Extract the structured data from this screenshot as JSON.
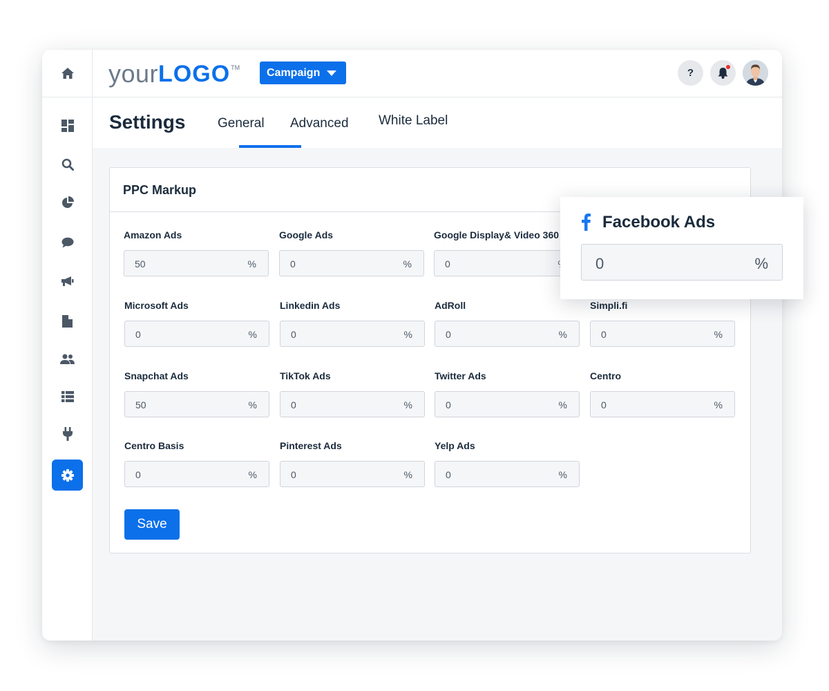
{
  "brand": {
    "logo_part1": "your",
    "logo_part2": "LOGO",
    "logo_tm": "TM"
  },
  "header": {
    "campaign_label": "Campaign",
    "help_label": "?"
  },
  "sidebar": {
    "items": [
      {
        "icon": "home-icon"
      },
      {
        "icon": "dashboard-icon"
      },
      {
        "icon": "search-icon"
      },
      {
        "icon": "pie-chart-icon"
      },
      {
        "icon": "chat-icon"
      },
      {
        "icon": "megaphone-icon"
      },
      {
        "icon": "document-icon"
      },
      {
        "icon": "users-icon"
      },
      {
        "icon": "list-icon"
      },
      {
        "icon": "plug-icon"
      },
      {
        "icon": "gear-icon",
        "active": true
      }
    ]
  },
  "settings": {
    "title": "Settings",
    "tabs": [
      {
        "label": "General"
      },
      {
        "label": "Advanced",
        "active": true
      },
      {
        "label": "White Label"
      }
    ]
  },
  "card": {
    "title": "PPC Markup",
    "unit": "%",
    "fields": [
      {
        "label": "Amazon Ads",
        "value": "50"
      },
      {
        "label": "Google Ads",
        "value": "0"
      },
      {
        "label": "Google Display& Video 360",
        "value": "0"
      },
      {
        "label": "Microsoft Ads",
        "value": "0"
      },
      {
        "label": "Linkedin Ads",
        "value": "0"
      },
      {
        "label": "AdRoll",
        "value": "0"
      },
      {
        "label": "Simpli.fi",
        "value": "0"
      },
      {
        "label": "Snapchat Ads",
        "value": "50"
      },
      {
        "label": "TikTok Ads",
        "value": "0"
      },
      {
        "label": "Twitter Ads",
        "value": "0"
      },
      {
        "label": "Centro",
        "value": "0"
      },
      {
        "label": "Centro Basis",
        "value": "0"
      },
      {
        "label": "Pinterest Ads",
        "value": "0"
      },
      {
        "label": "Yelp Ads",
        "value": "0"
      }
    ],
    "save_label": "Save"
  },
  "popup": {
    "title": "Facebook Ads",
    "value": "0",
    "unit": "%"
  },
  "colors": {
    "accent": "#0b70ea",
    "notification": "#e5322d"
  }
}
